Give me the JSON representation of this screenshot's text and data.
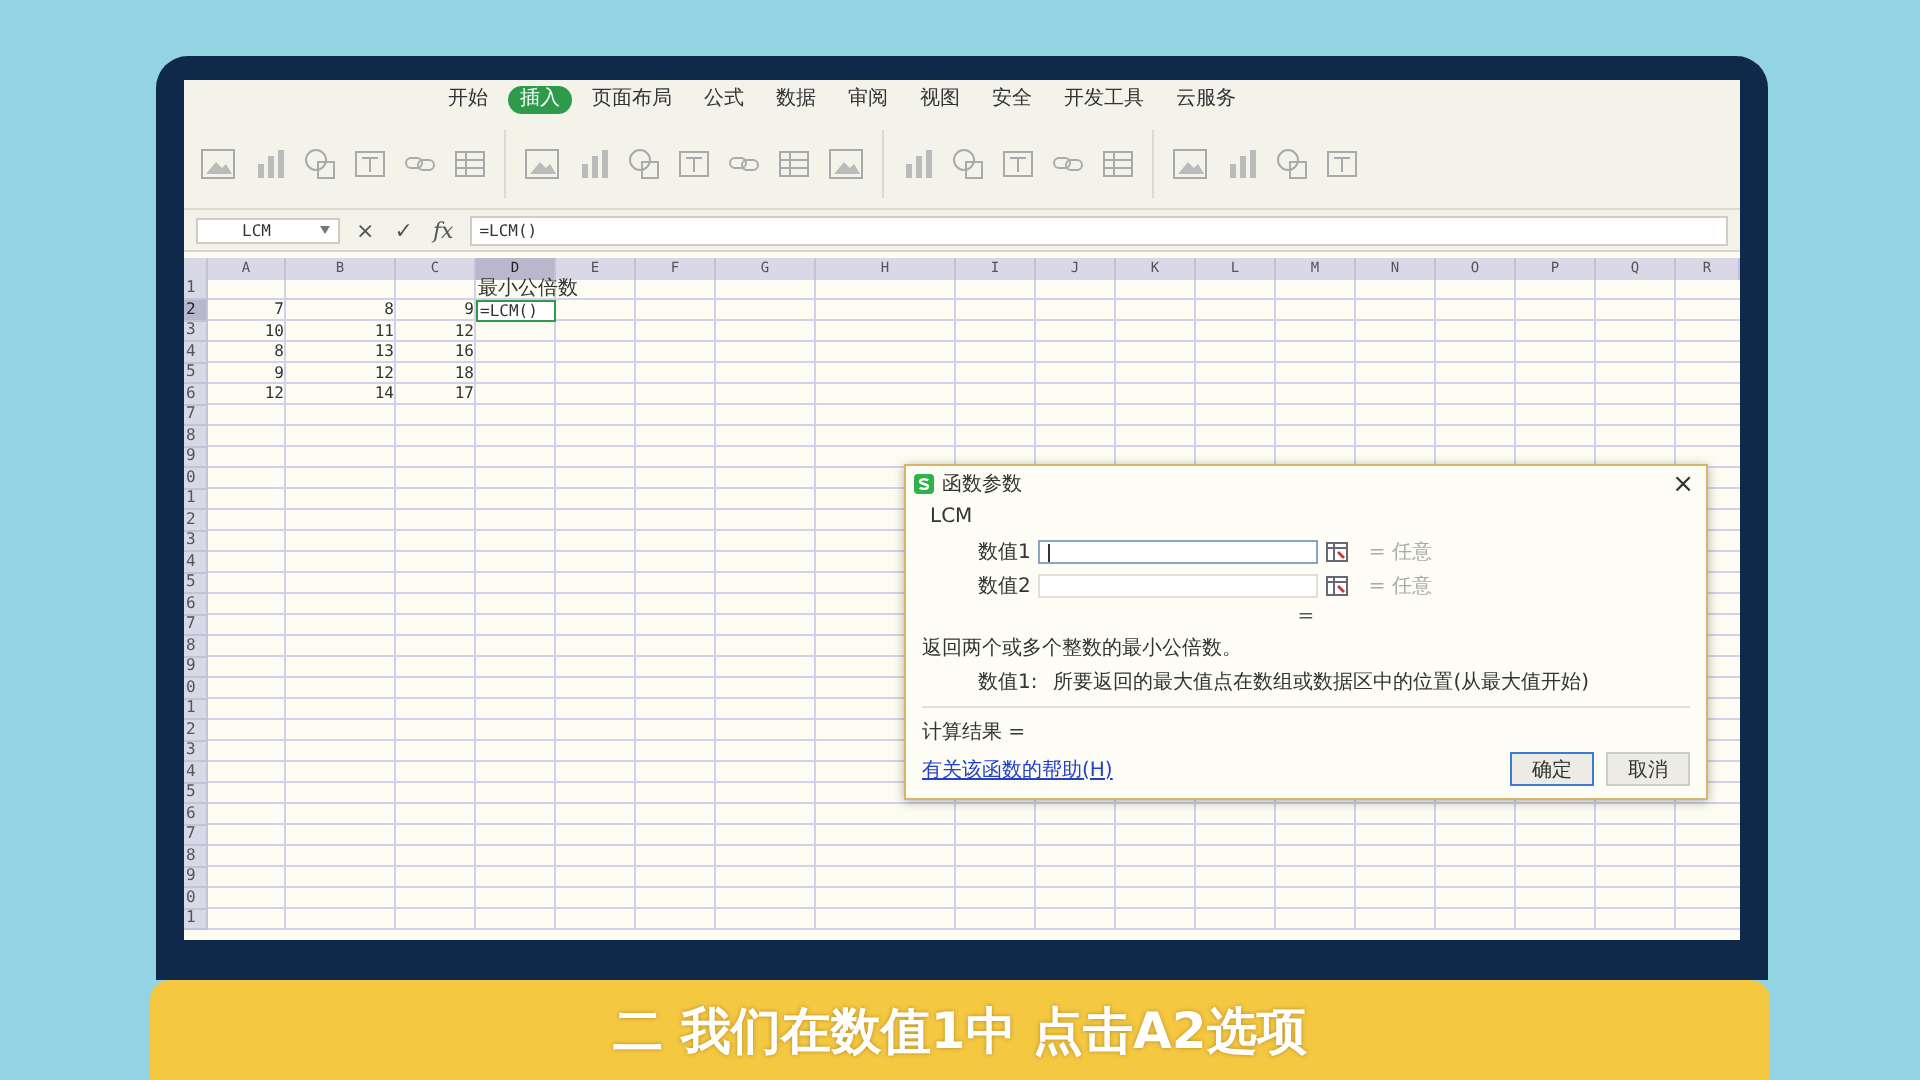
{
  "menu_tabs": [
    {
      "label": "开始",
      "selected": false
    },
    {
      "label": "插入",
      "selected": true
    },
    {
      "label": "页面布局",
      "selected": false
    },
    {
      "label": "公式",
      "selected": false
    },
    {
      "label": "数据",
      "selected": false
    },
    {
      "label": "审阅",
      "selected": false
    },
    {
      "label": "视图",
      "selected": false
    },
    {
      "label": "安全",
      "selected": false
    },
    {
      "label": "开发工具",
      "selected": false
    },
    {
      "label": "云服务",
      "selected": false
    }
  ],
  "formula_bar": {
    "name_box": "LCM",
    "cancel": "×",
    "confirm": "✓",
    "fx": "fx",
    "formula": "=LCM()"
  },
  "sheet": {
    "columns": [
      {
        "label": "A",
        "selected": false
      },
      {
        "label": "B",
        "selected": false
      },
      {
        "label": "C",
        "selected": false
      },
      {
        "label": "D",
        "selected": true
      },
      {
        "label": "E",
        "selected": false
      },
      {
        "label": "F",
        "selected": false
      },
      {
        "label": "G",
        "selected": false
      },
      {
        "label": "H",
        "selected": false
      },
      {
        "label": "I",
        "selected": false
      },
      {
        "label": "J",
        "selected": false
      },
      {
        "label": "K",
        "selected": false
      },
      {
        "label": "L",
        "selected": false
      },
      {
        "label": "M",
        "selected": false
      },
      {
        "label": "N",
        "selected": false
      },
      {
        "label": "O",
        "selected": false
      },
      {
        "label": "P",
        "selected": false
      },
      {
        "label": "Q",
        "selected": false
      },
      {
        "label": "R",
        "selected": false
      }
    ],
    "rows": [
      {
        "label": "1",
        "selected": false,
        "cells": {
          "D": "最小公倍数"
        }
      },
      {
        "label": "2",
        "selected": true,
        "cells": {
          "A": "7",
          "B": "8",
          "C": "9",
          "D": "=LCM()"
        }
      },
      {
        "label": "3",
        "selected": false,
        "cells": {
          "A": "10",
          "B": "11",
          "C": "12"
        }
      },
      {
        "label": "4",
        "selected": false,
        "cells": {
          "A": "8",
          "B": "13",
          "C": "16"
        }
      },
      {
        "label": "5",
        "selected": false,
        "cells": {
          "A": "9",
          "B": "12",
          "C": "18"
        }
      },
      {
        "label": "6",
        "selected": false,
        "cells": {
          "A": "12",
          "B": "14",
          "C": "17"
        }
      },
      {
        "label": "7",
        "selected": false
      },
      {
        "label": "8",
        "selected": false
      },
      {
        "label": "9",
        "selected": false
      },
      {
        "label": "0",
        "selected": false
      },
      {
        "label": "1",
        "selected": false
      },
      {
        "label": "2",
        "selected": false
      },
      {
        "label": "3",
        "selected": false
      },
      {
        "label": "4",
        "selected": false
      },
      {
        "label": "5",
        "selected": false
      },
      {
        "label": "6",
        "selected": false
      },
      {
        "label": "7",
        "selected": false
      },
      {
        "label": "8",
        "selected": false
      },
      {
        "label": "9",
        "selected": false
      },
      {
        "label": "0",
        "selected": false
      },
      {
        "label": "1",
        "selected": false
      },
      {
        "label": "2",
        "selected": false
      },
      {
        "label": "3",
        "selected": false
      },
      {
        "label": "4",
        "selected": false
      },
      {
        "label": "5",
        "selected": false
      },
      {
        "label": "6",
        "selected": false
      },
      {
        "label": "7",
        "selected": false
      },
      {
        "label": "8",
        "selected": false
      },
      {
        "label": "9",
        "selected": false
      },
      {
        "label": "0",
        "selected": false
      },
      {
        "label": "1",
        "selected": false
      }
    ]
  },
  "dialog": {
    "title": "函数参数",
    "close": "×",
    "function": "LCM",
    "args": [
      {
        "label": "数值1",
        "focused": true,
        "hint": "= 任意"
      },
      {
        "label": "数值2",
        "focused": false,
        "hint": "= 任意"
      }
    ],
    "result_eq": "=",
    "description": "返回两个或多个整数的最小公倍数。",
    "arg_help": {
      "label": "数值1:",
      "text": "所要返回的最大值点在数组或数据区中的位置(从最大值开始)"
    },
    "result_label": "计算结果 =",
    "help_link": "有关该函数的帮助(H)",
    "buttons": [
      {
        "label": "确定",
        "default": true
      },
      {
        "label": "取消",
        "default": false
      }
    ]
  },
  "subtitle": "二 我们在数值1中 点击A2选项"
}
